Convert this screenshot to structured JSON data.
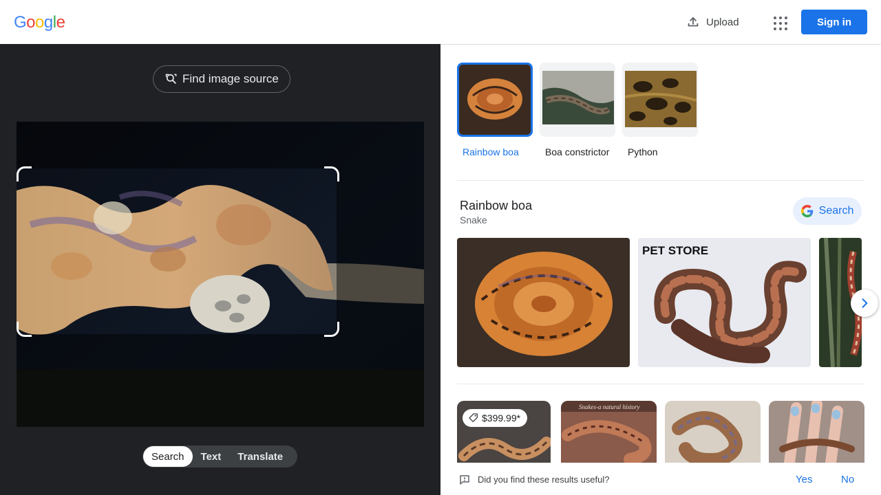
{
  "header": {
    "logo_letters": [
      {
        "ch": "G",
        "color": "#4285F4"
      },
      {
        "ch": "o",
        "color": "#EA4335"
      },
      {
        "ch": "o",
        "color": "#FBBC05"
      },
      {
        "ch": "g",
        "color": "#4285F4"
      },
      {
        "ch": "l",
        "color": "#34A853"
      },
      {
        "ch": "e",
        "color": "#EA4335"
      }
    ],
    "upload_label": "Upload",
    "apps_icon": "apps-grid-icon",
    "signin_label": "Sign in"
  },
  "left": {
    "find_source_label": "Find image source",
    "modes": [
      "Search",
      "Text",
      "Translate"
    ],
    "active_mode": "Search"
  },
  "right": {
    "chips": [
      {
        "label": "Rainbow boa",
        "selected": true
      },
      {
        "label": "Boa constrictor",
        "selected": false
      },
      {
        "label": "Python",
        "selected": false
      }
    ],
    "entity": {
      "title": "Rainbow boa",
      "subtitle": "Snake",
      "search_label": "Search"
    },
    "result_images": [
      {
        "name": "coiled-rainbow-boa"
      },
      {
        "name": "petstore-rainbow-boa",
        "overlay_text": "PET STORE"
      },
      {
        "name": "boa-on-branch"
      }
    ],
    "products": [
      {
        "price": "$399.99*"
      },
      {
        "caption": "Snakes-a natural history"
      },
      {},
      {}
    ],
    "feedback": {
      "question": "Did you find these results useful?",
      "yes": "Yes",
      "no": "No"
    }
  },
  "colors": {
    "accent": "#1a73e8",
    "left_bg": "#202124",
    "chip_selected": "#1a73e8"
  }
}
